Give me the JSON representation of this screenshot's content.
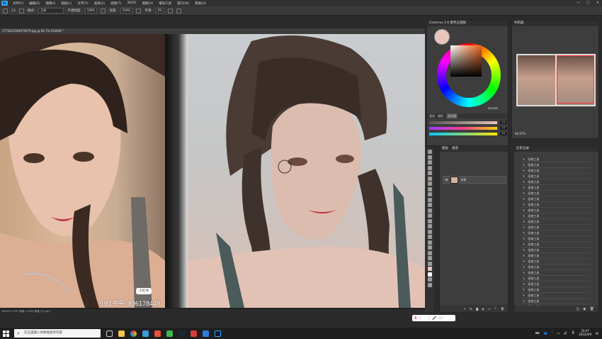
{
  "menubar": {
    "items": [
      "文件(F)",
      "编辑(E)",
      "图像(I)",
      "图层(L)",
      "文字(Y)",
      "选择(S)",
      "滤镜(T)",
      "3D(D)",
      "视图(V)",
      "增效工具",
      "窗口(W)",
      "帮助(H)"
    ],
    "app_logo": "Ps",
    "window_controls": [
      "—",
      "▢",
      "✕"
    ]
  },
  "options": {
    "brush_size": "13",
    "mode_label": "模式:",
    "mode_value": "正常",
    "opacity_label": "不透明度:",
    "opacity_value": "100%",
    "flow_label": "流量:",
    "flow_value": "100%",
    "smooth_label": "平滑:",
    "smooth_value": "0%"
  },
  "document": {
    "tab_title": "5770422584079470.jpg @ 66.7% (RGB/8) *",
    "status": "66.67%   1787 像素 x 2528 像素 (72 ppi)"
  },
  "canvas": {
    "photo_caption": "小红书号: 896178449",
    "photo_badge": "小红书"
  },
  "coolorus": {
    "title": "Coolorus 2.6 配色王面板",
    "hex_value": "E8C5BD",
    "tabs": [
      "混合",
      "调色",
      "混合器"
    ],
    "bar_values": [
      "11",
      "17",
      "51"
    ]
  },
  "navigator": {
    "title": "导航器",
    "zoom": "66.67%"
  },
  "layers": {
    "tabs": [
      "图层",
      "通道"
    ],
    "layer_name": "背景"
  },
  "history": {
    "title": "历史记录",
    "items": [
      "画笔工具",
      "画笔工具",
      "画笔工具",
      "画笔工具",
      "画笔工具",
      "画笔工具",
      "画笔工具",
      "画笔工具",
      "画笔工具",
      "画笔工具",
      "画笔工具",
      "画笔工具",
      "画笔工具",
      "画笔工具",
      "画笔工具",
      "画笔工具",
      "画笔工具",
      "画笔工具",
      "画笔工具",
      "画笔工具",
      "画笔工具",
      "画笔工具",
      "画笔工具",
      "画笔工具",
      "画笔工具",
      "画笔工具",
      "画笔工具",
      "画笔工具",
      "画笔工具"
    ]
  },
  "taskbar": {
    "search_placeholder": "在这里输入你要搜索的内容",
    "time": "22:47",
    "date": "2022/4/9",
    "ime_label": "中",
    "lang": "英"
  },
  "colors": {
    "foreground": "#e8c5bd",
    "accent": "#31a8ff"
  }
}
